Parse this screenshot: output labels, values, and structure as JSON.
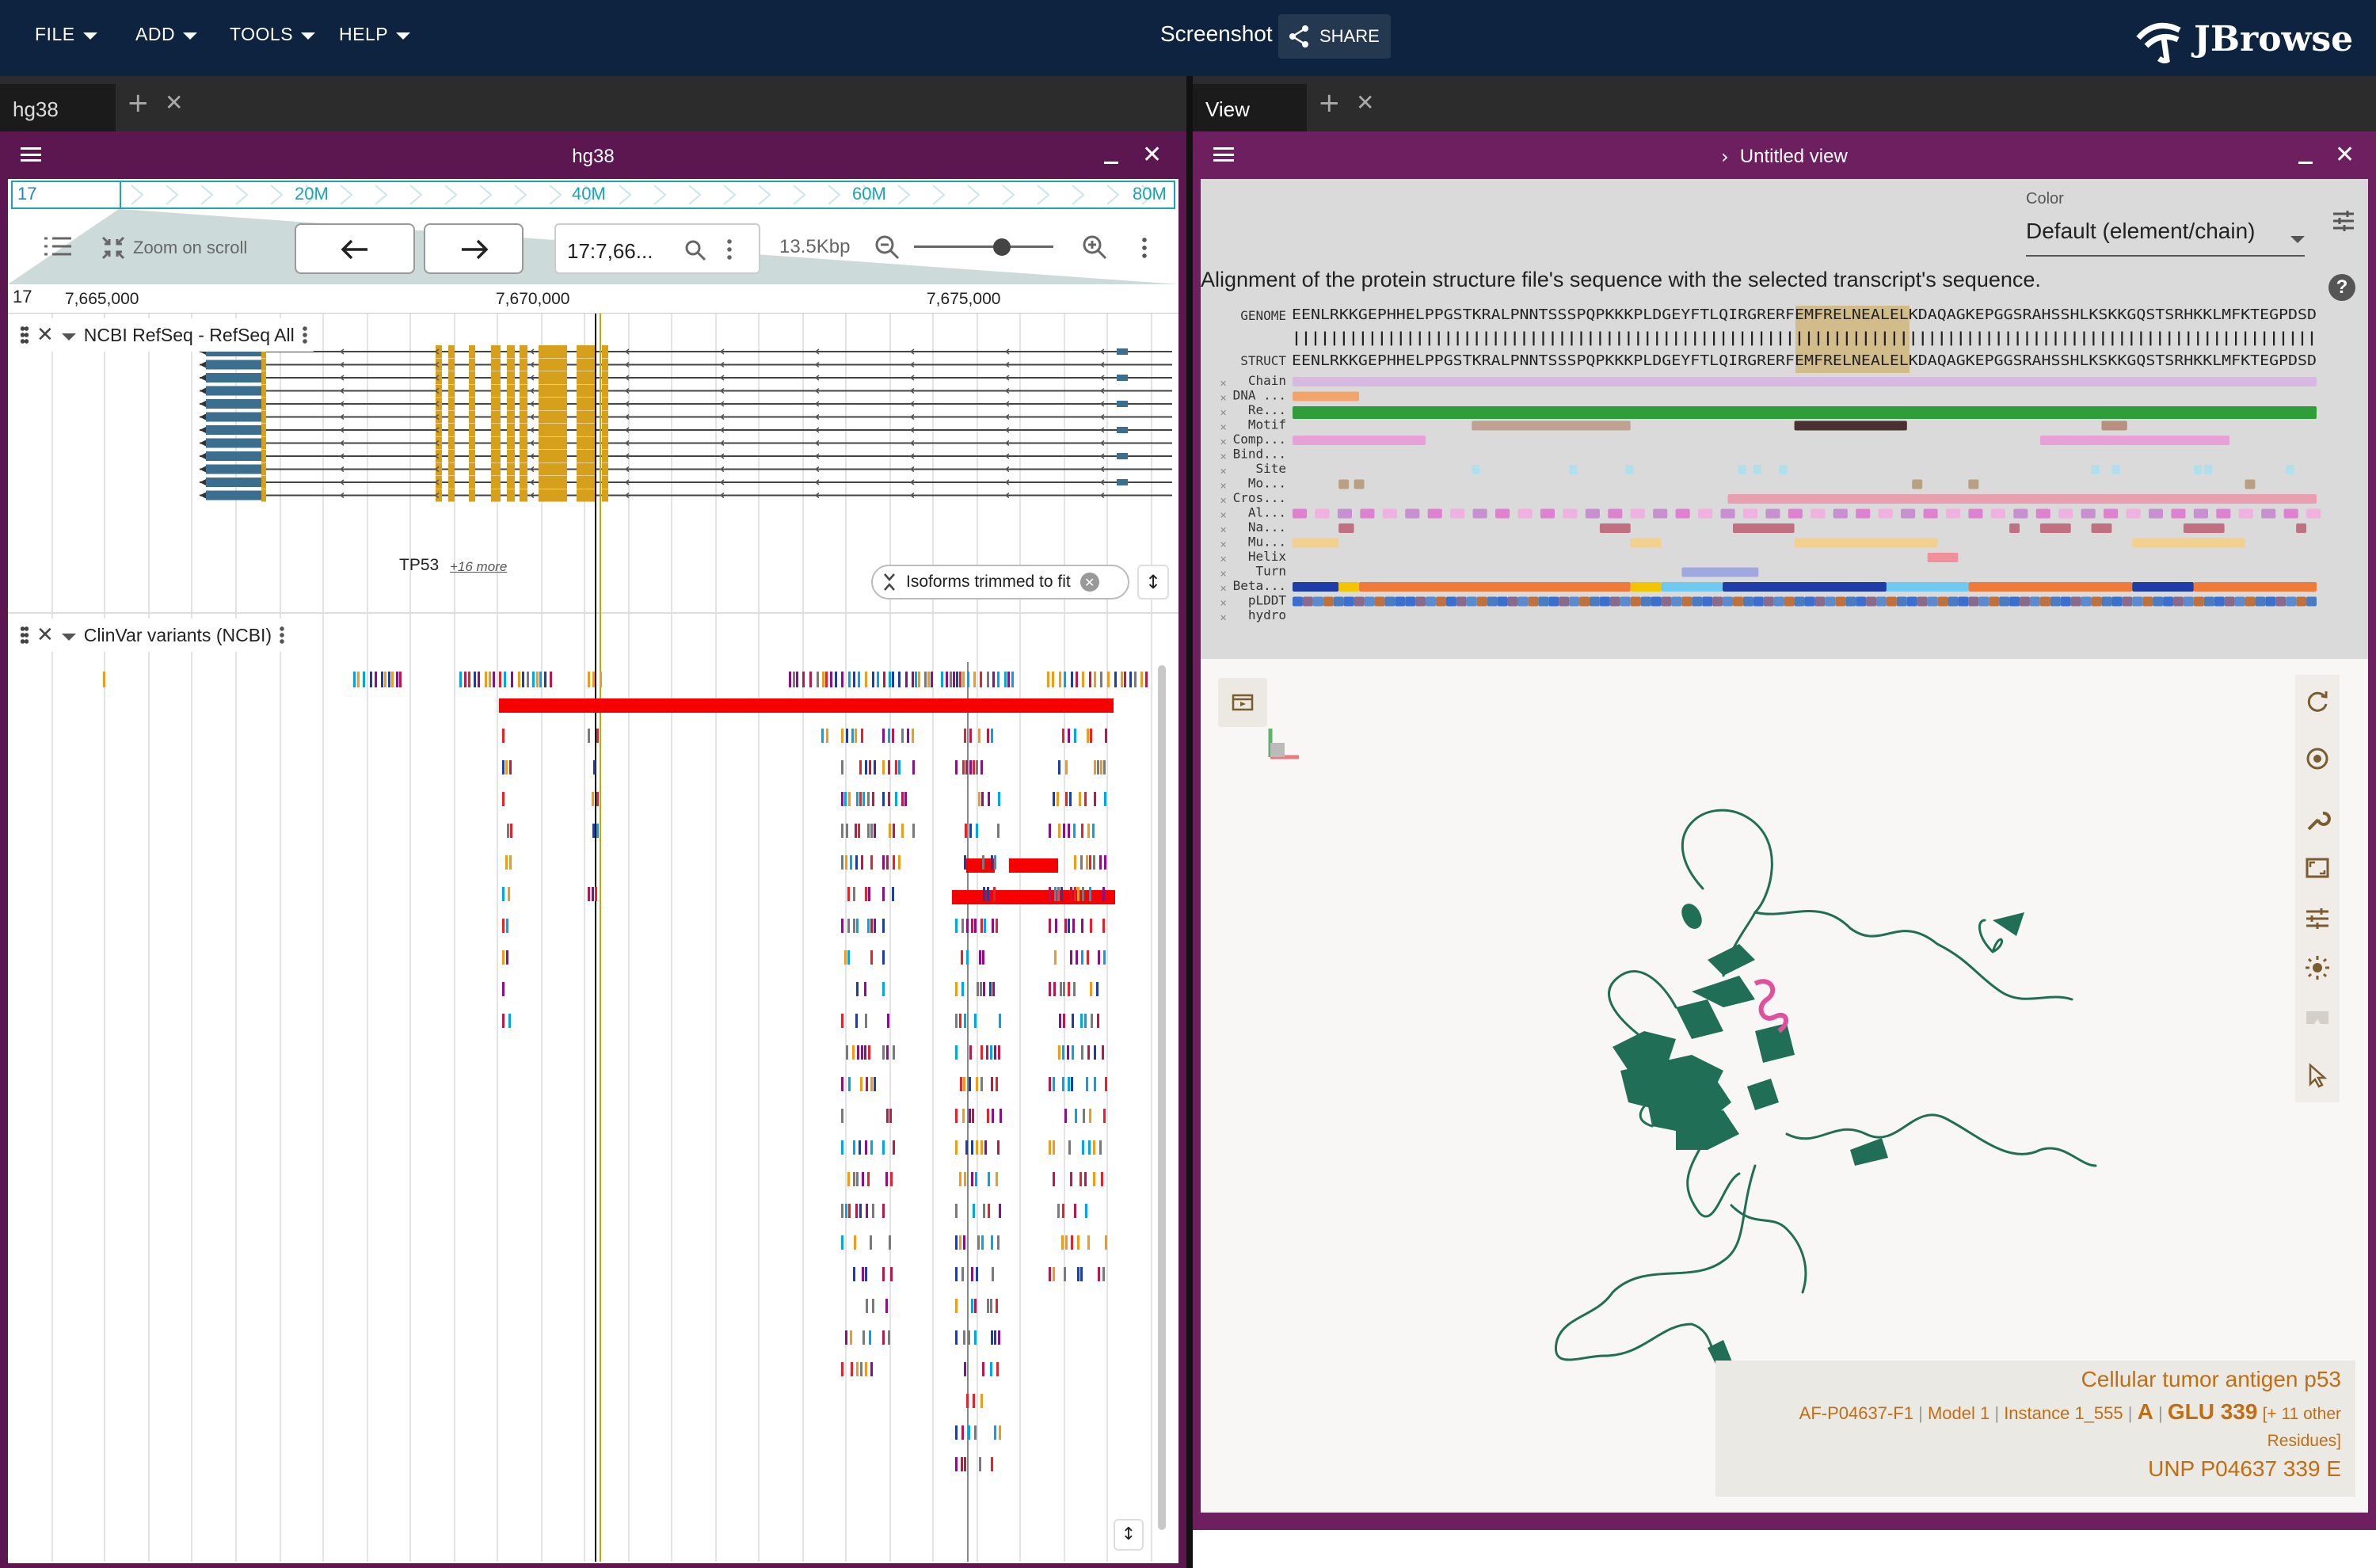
{
  "app": {
    "logo_text": "JBrowse",
    "session_name": "Screenshot",
    "share_label": "SHARE"
  },
  "menu": [
    "FILE",
    "ADD",
    "TOOLS",
    "HELP"
  ],
  "colors": {
    "topbar": "#0d233f",
    "lgv_header": "#5c1650",
    "protein_header": "#6d1f5f",
    "gene_utr": "#3c6e8f",
    "gene_cds": "#d6a01c",
    "structure": "#1f6e55",
    "highlight": "#e0509c"
  },
  "left_tab": {
    "label": "hg38"
  },
  "right_tab": {
    "label": "View"
  },
  "lgv": {
    "title": "hg38",
    "overview": {
      "chrom": "17",
      "ticks": [
        "20M",
        "40M",
        "60M",
        "80M"
      ]
    },
    "zoom_on_scroll": "Zoom on scroll",
    "locstring": "17:7,66...",
    "span": "13.5Kbp",
    "ruler": {
      "chrom": "17",
      "ticks": [
        "7,665,000",
        "7,670,000",
        "7,675,000"
      ]
    },
    "tracks": {
      "refseq": {
        "name": "NCBI RefSeq - RefSeq All",
        "gene_label": "TP53",
        "more": "+16 more",
        "trim_note": "Isoforms trimmed to fit"
      },
      "clinvar": {
        "name": "ClinVar variants (NCBI)"
      }
    }
  },
  "protein": {
    "title": "Untitled view",
    "color_label": "Color",
    "color_value": "Default (element/chain)",
    "alignment_caption": "Alignment of the protein structure file's sequence with the selected transcript's sequence.",
    "genome_label": "GENOME",
    "struct_label": "STRUCT",
    "genome_seq": "EENLRKKGEPHHELPPGSTKRALPNNTSSSPQPKKKPLDGEYFTLQIRGRERFEMFRELNEALELKDAQAGKEPGGSRAHSSHLKSKKGQSTSRHKKLMFKTEGPDSD",
    "struct_seq": "EENLRKKGEPHHELPPGSTKRALPNNTSSSPQPKKKPLDGEYFTLQIRGRERFEMFRELNEALELKDAQAGKEPGGSRAHSSHLKSKKGQSTSRHKKLMFKTEGPDSD",
    "feature_labels": [
      "Chain",
      "DNA ...",
      "Re...",
      "Motif",
      "Comp...",
      "Bind...",
      "Site",
      "Mo...",
      "Cros...",
      "Al...",
      "Na...",
      "Mu...",
      "Helix",
      "Turn",
      "Beta...",
      "pLDDT",
      "hydro"
    ],
    "info": {
      "name": "Cellular tumor antigen p53",
      "entry": "AF-P04637-F1",
      "model": "Model 1",
      "instance": "Instance 1_555",
      "chain": "A",
      "residue": "GLU 339",
      "extra": "[+ 11 other",
      "extra2": "Residues]",
      "unp": "UNP P04637 339 E"
    }
  }
}
